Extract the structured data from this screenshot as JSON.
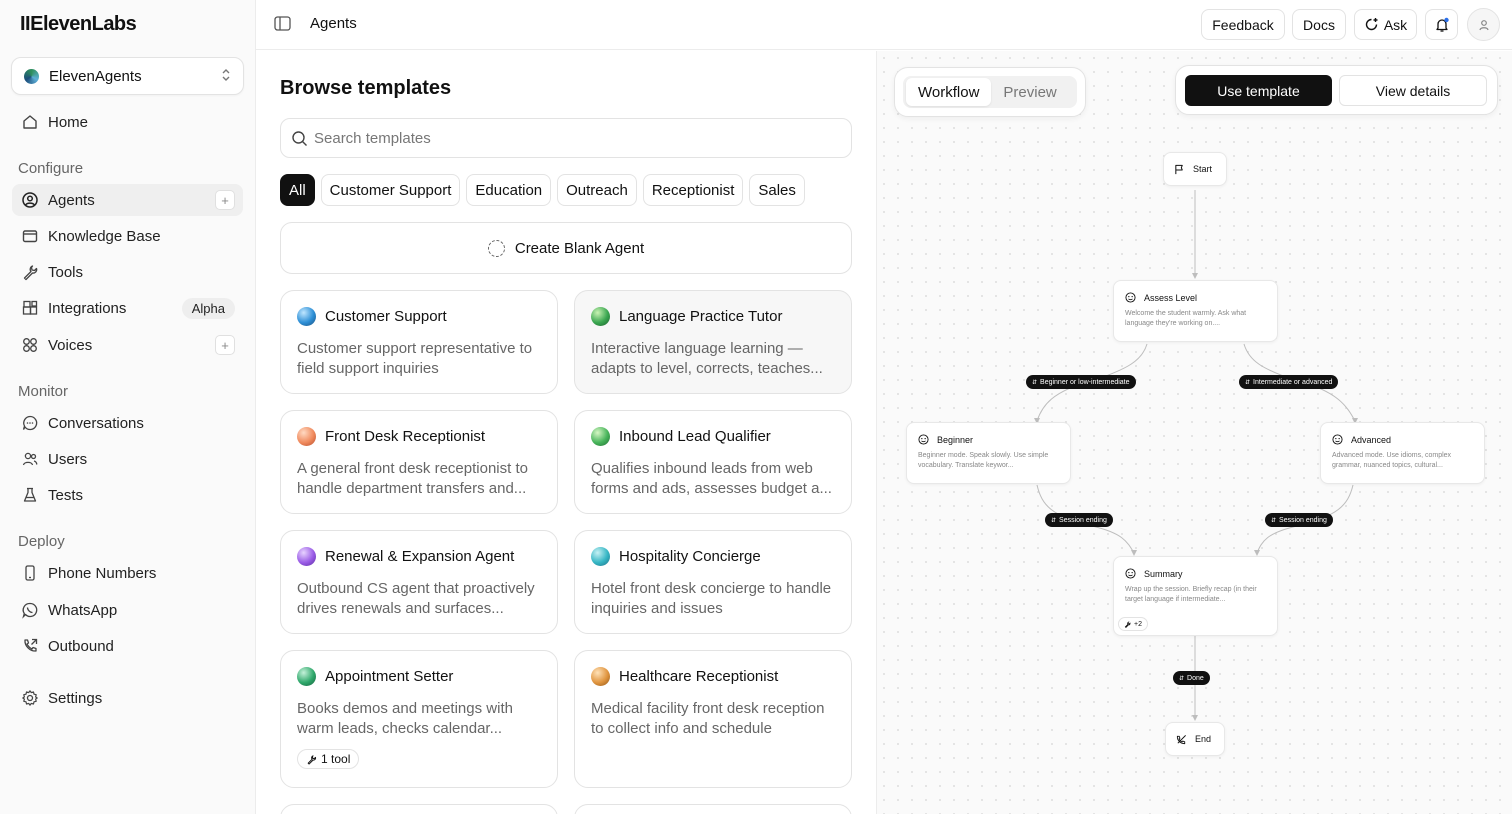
{
  "brand": {
    "logo": "IIElevenLabs"
  },
  "workspace": {
    "name": "ElevenAgents"
  },
  "sidebar": {
    "home": "Home",
    "configure_label": "Configure",
    "configure": [
      {
        "label": "Agents",
        "plus": "+"
      },
      {
        "label": "Knowledge Base"
      },
      {
        "label": "Tools"
      },
      {
        "label": "Integrations",
        "badge": "Alpha"
      },
      {
        "label": "Voices",
        "plus": "+"
      }
    ],
    "monitor_label": "Monitor",
    "monitor": [
      {
        "label": "Conversations"
      },
      {
        "label": "Users"
      },
      {
        "label": "Tests"
      }
    ],
    "deploy_label": "Deploy",
    "deploy": [
      {
        "label": "Phone Numbers"
      },
      {
        "label": "WhatsApp"
      },
      {
        "label": "Outbound"
      }
    ],
    "settings": "Settings"
  },
  "topbar": {
    "crumb": "Agents",
    "feedback": "Feedback",
    "docs": "Docs",
    "ask": "Ask"
  },
  "browse": {
    "title": "Browse templates",
    "search_placeholder": "Search templates",
    "filters": [
      "All",
      "Customer Support",
      "Education",
      "Outreach",
      "Receptionist",
      "Sales"
    ],
    "blank": "Create Blank Agent",
    "cards": [
      {
        "title": "Customer Support",
        "desc": "Customer support representative to field support inquiries"
      },
      {
        "title": "Language Practice Tutor",
        "desc": "Interactive language learning — adapts to level, corrects, teaches..."
      },
      {
        "title": "Front Desk Receptionist",
        "desc": "A general front desk receptionist to handle department transfers and..."
      },
      {
        "title": "Inbound Lead Qualifier",
        "desc": "Qualifies inbound leads from web forms and ads, assesses budget a..."
      },
      {
        "title": "Renewal & Expansion Agent",
        "desc": "Outbound CS agent that proactively drives renewals and surfaces..."
      },
      {
        "title": "Hospitality Concierge",
        "desc": "Hotel front desk concierge to handle inquiries and issues"
      },
      {
        "title": "Appointment Setter",
        "desc": "Books demos and meetings with warm leads, checks calendar...",
        "tool": "1 tool"
      },
      {
        "title": "Healthcare Receptionist",
        "desc": "Medical facility front desk reception to collect info and schedule"
      }
    ]
  },
  "workflow": {
    "tabs": [
      "Workflow",
      "Preview"
    ],
    "use_template": "Use template",
    "view_details": "View details",
    "nodes": {
      "start": "Start",
      "assess": {
        "title": "Assess Level",
        "desc": "Welcome the student warmly. Ask what language they're working on...."
      },
      "beginner": {
        "title": "Beginner",
        "desc": "Beginner mode. Speak slowly. Use simple vocabulary. Translate keywor..."
      },
      "advanced": {
        "title": "Advanced",
        "desc": "Advanced mode. Use idioms, complex grammar, nuanced topics, cultural..."
      },
      "summary": {
        "title": "Summary",
        "desc": "Wrap up the session. Briefly recap (in their target language if intermediate...",
        "tools": "+2"
      },
      "end": "End"
    },
    "edges": {
      "beginner": "Beginner or low-intermediate",
      "advanced": "Intermediate or advanced",
      "session_left": "Session ending",
      "session_right": "Session ending",
      "done": "Done"
    }
  }
}
